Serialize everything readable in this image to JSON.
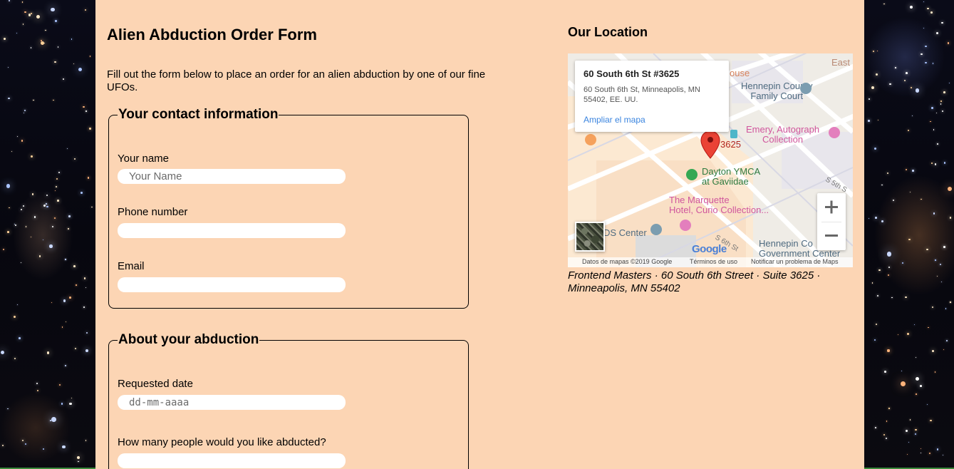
{
  "form": {
    "title": "Alien Abduction Order Form",
    "intro": "Fill out the form below to place an order for an alien abduction by one of our fine UFOs.",
    "contact": {
      "legend": "Your contact information",
      "name_label": "Your name",
      "name_placeholder": "Your Name",
      "phone_label": "Phone number",
      "email_label": "Email"
    },
    "abduction": {
      "legend": "About your abduction",
      "date_label": "Requested date",
      "date_placeholder": "dd-mm-aaaa",
      "people_label": "How many people would you like abducted?"
    }
  },
  "location": {
    "title": "Our Location",
    "address": "Frontend Masters · 60 South 6th Street · Suite 3625 · Minneapolis, MN 55402",
    "map": {
      "info_title": "60 South 6th St #3625",
      "info_address": "60 South 6th St, Minneapolis, MN 55402, EE. UU.",
      "info_link": "Ampliar el mapa",
      "pin_label": "3625",
      "places": {
        "hennepin_county": "Hennepin County\nFamily Court",
        "emery": "Emery, Autograph\nCollection",
        "dayton": "Dayton YMCA\nat Gaviidae",
        "marquette": "The Marquette\nHotel, Curio Collection...",
        "hennepin_gov": "Hennepin Co\nGovernment Center",
        "ids_center": "DS Center",
        "east": "East",
        "ouse": "ouse",
        "street": "S 5th S",
        "street2": "S 6th St"
      },
      "google_logo": "Google",
      "footer_data": "Datos de mapas ©2019 Google",
      "footer_terms": "Términos de uso",
      "footer_report": "Notificar un problema de Maps"
    }
  },
  "colors": {
    "page_bg": "#fcd5b4",
    "link": "#3a84df",
    "pin": "#ea4335",
    "place_pink": "#d0569d",
    "place_green": "#34a853",
    "place_blue": "#7b9db0"
  }
}
